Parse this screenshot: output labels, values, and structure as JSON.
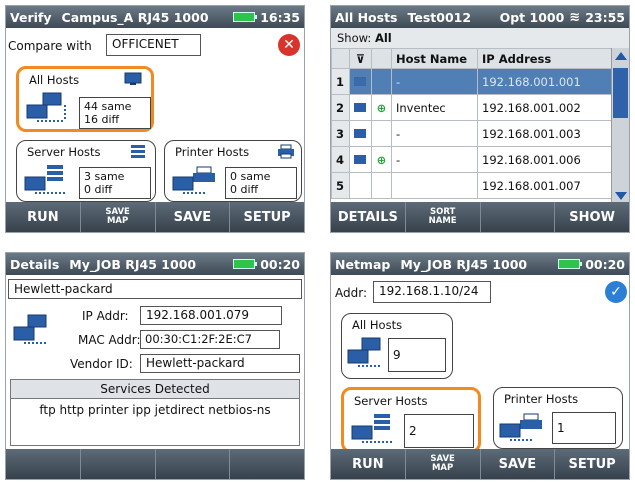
{
  "verify": {
    "title_left": "Verify",
    "title_mid": "Campus_A  RJ45 1000",
    "time": "16:35",
    "compare_label": "Compare with",
    "compare_value": "OFFICENET",
    "all_hosts": {
      "title": "All Hosts",
      "line1": "44 same",
      "line2": "16 diff"
    },
    "server_hosts": {
      "title": "Server Hosts",
      "line1": "3 same",
      "line2": "0 diff"
    },
    "printer_hosts": {
      "title": "Printer Hosts",
      "line1": "0 same",
      "line2": "0 diff"
    },
    "buttons": {
      "run": "RUN",
      "save_map_1": "SAVE",
      "save_map_2": "MAP",
      "save": "SAVE",
      "setup": "SETUP"
    }
  },
  "allhosts": {
    "title_left": "All Hosts",
    "title_mid": "Test0012",
    "title_opt": "Opt 1000",
    "time": "23:55",
    "show_label": "Show:",
    "show_value": "All",
    "columns": {
      "host_name": "Host Name",
      "ip": "IP Address"
    },
    "rows": [
      {
        "num": "1",
        "name": "-",
        "ip": "192.168.001.001",
        "selected": true,
        "plus": false
      },
      {
        "num": "2",
        "name": "Inventec",
        "ip": "192.168.001.002",
        "selected": false,
        "plus": true
      },
      {
        "num": "3",
        "name": "-",
        "ip": "192.168.001.003",
        "selected": false,
        "plus": false
      },
      {
        "num": "4",
        "name": "-",
        "ip": "192.168.001.006",
        "selected": false,
        "plus": true
      },
      {
        "num": "5",
        "name": "",
        "ip": "192.168.001.007",
        "selected": false,
        "plus": false
      }
    ],
    "buttons": {
      "details": "DETAILS",
      "sort_1": "SORT",
      "sort_2": "NAME",
      "show": "SHOW"
    }
  },
  "details": {
    "title_left": "Details",
    "title_mid": "My_JOB      RJ45 1000",
    "time": "00:20",
    "device_name": "Hewlett-packard",
    "ip_label": "IP Addr:",
    "ip_value": "192.168.001.079",
    "mac_label": "MAC Addr:",
    "mac_value": "00:30:C1:2F:2E:C7",
    "vendor_label": "Vendor ID:",
    "vendor_value": "Hewlett-packard",
    "services_title": "Services Detected",
    "services_list": "ftp http printer ipp jetdirect netbios-ns"
  },
  "netmap": {
    "title_left": "Netmap",
    "title_mid": "My_JOB      RJ45 1000",
    "time": "00:20",
    "addr_label": "Addr:",
    "addr_value": "192.168.1.10/24",
    "all_hosts": {
      "title": "All Hosts",
      "count": "9"
    },
    "server_hosts": {
      "title": "Server Hosts",
      "count": "2"
    },
    "printer_hosts": {
      "title": "Printer Hosts",
      "count": "1"
    },
    "buttons": {
      "run": "RUN",
      "save_map_1": "SAVE",
      "save_map_2": "MAP",
      "save": "SAVE",
      "setup": "SETUP"
    }
  },
  "colors": {
    "accent_orange": "#f28a1f",
    "title_bar": "#4a5662",
    "selected_row": "#4f7fb4",
    "check_blue": "#2b7fd4",
    "close_red": "#d9342b"
  }
}
